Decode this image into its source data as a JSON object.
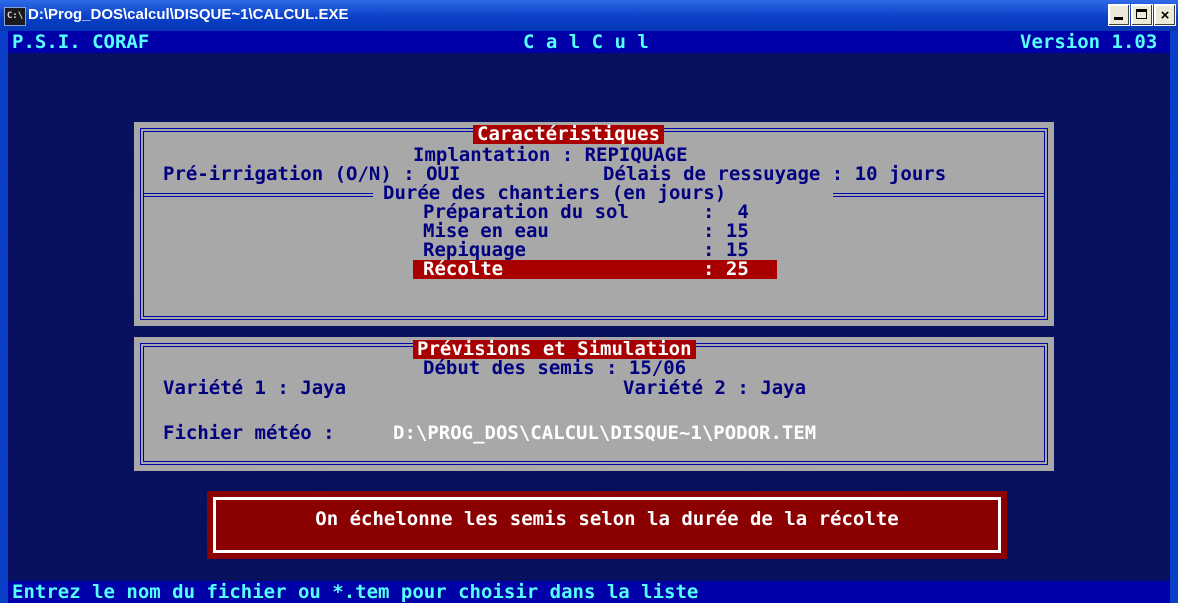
{
  "window": {
    "icon_text": "C:\\",
    "title": "D:\\Prog_DOS\\calcul\\DISQUE~1\\CALCUL.EXE",
    "minimize": "_",
    "maximize": "□",
    "close": "×"
  },
  "header": {
    "left": "P.S.I. CORAF",
    "center": "C a l C u l",
    "right": "Version 1.03"
  },
  "caracteristiques": {
    "title": "Caractéristiques",
    "implantation": "Implantation : REPIQUAGE",
    "pre_irrigation": "Pré-irrigation (O/N) : OUI",
    "delais": "Délais de ressuyage : 10 jours",
    "duree_title": "Durée des chantiers (en jours)",
    "rows": [
      {
        "label": "Préparation du sol",
        "value": ":  4"
      },
      {
        "label": "Mise en eau",
        "value": ": 15"
      },
      {
        "label": "Repiquage",
        "value": ": 15"
      },
      {
        "label": "Récolte",
        "value": ": 25"
      }
    ],
    "selected_index": 3
  },
  "previsions": {
    "title": "Prévisions et Simulation",
    "debut": "Début des semis : 15/06",
    "variete1": "Variété 1 : Jaya",
    "variete2": "Variété 2 : Jaya",
    "fichier_label": "Fichier météo :",
    "fichier_value": "D:\\PROG_DOS\\CALCUL\\DISQUE~1\\PODOR.TEM"
  },
  "message": "On échelonne les semis selon la durée de la récolte",
  "status": "Entrez le nom du fichier ou *.tem pour choisir dans la liste",
  "colors": {
    "console_bg": "#050E5C",
    "bar_bg": "#0000A8",
    "bar_text": "#55FFFF",
    "panel_bg": "#A8A8A8",
    "panel_text": "#000080",
    "highlight": "#A80000"
  }
}
